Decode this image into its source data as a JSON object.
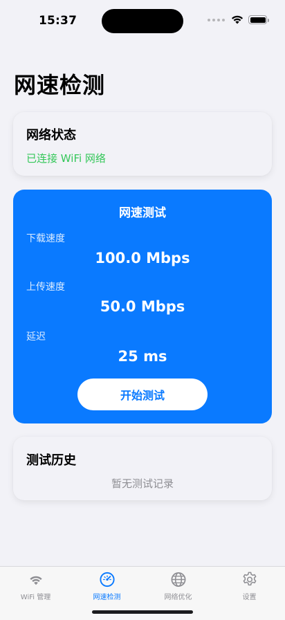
{
  "status_bar": {
    "time": "15:37"
  },
  "page_title": "网速检测",
  "network_status": {
    "title": "网络状态",
    "status_text": "已连接 WiFi 网络",
    "status_color": "#34c759"
  },
  "speed_test": {
    "title": "网速测试",
    "download_label": "下载速度",
    "download_value": "100.0 Mbps",
    "upload_label": "上传速度",
    "upload_value": "50.0 Mbps",
    "latency_label": "延迟",
    "latency_value": "25 ms",
    "start_button_label": "开始测试",
    "accent_color": "#0a7aff"
  },
  "history": {
    "title": "测试历史",
    "empty_text": "暂无测试记录"
  },
  "tab_bar": {
    "items": [
      {
        "label": "WiFi 管理",
        "icon": "wifi-icon",
        "active": false
      },
      {
        "label": "网速检测",
        "icon": "speedometer-icon",
        "active": true
      },
      {
        "label": "网络优化",
        "icon": "globe-icon",
        "active": false
      },
      {
        "label": "设置",
        "icon": "gear-icon",
        "active": false
      }
    ]
  }
}
